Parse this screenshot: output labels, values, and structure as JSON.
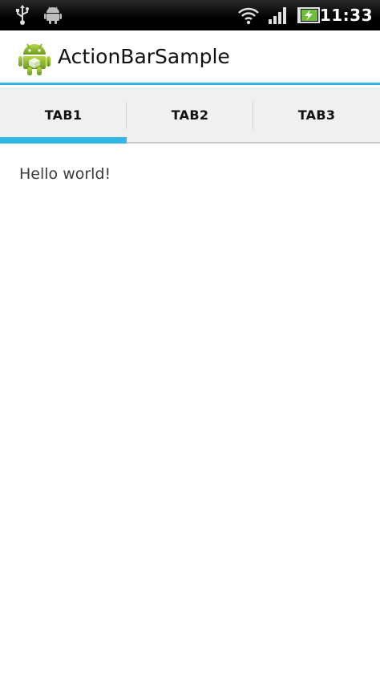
{
  "status_bar": {
    "time": "11:33",
    "icons": [
      "usb-icon",
      "android-notification-icon",
      "wifi-icon",
      "signal-icon",
      "battery-charging-icon"
    ]
  },
  "action_bar": {
    "title": "ActionBarSample",
    "icon": "android-launcher-icon"
  },
  "tabs": [
    {
      "label": "TAB1",
      "selected": true
    },
    {
      "label": "TAB2",
      "selected": false
    },
    {
      "label": "TAB3",
      "selected": false
    }
  ],
  "content": {
    "text": "Hello world!"
  },
  "colors": {
    "accent": "#33b5e5",
    "status_bar_bg": "#000000",
    "tab_bar_bg": "#f0f0f0"
  }
}
